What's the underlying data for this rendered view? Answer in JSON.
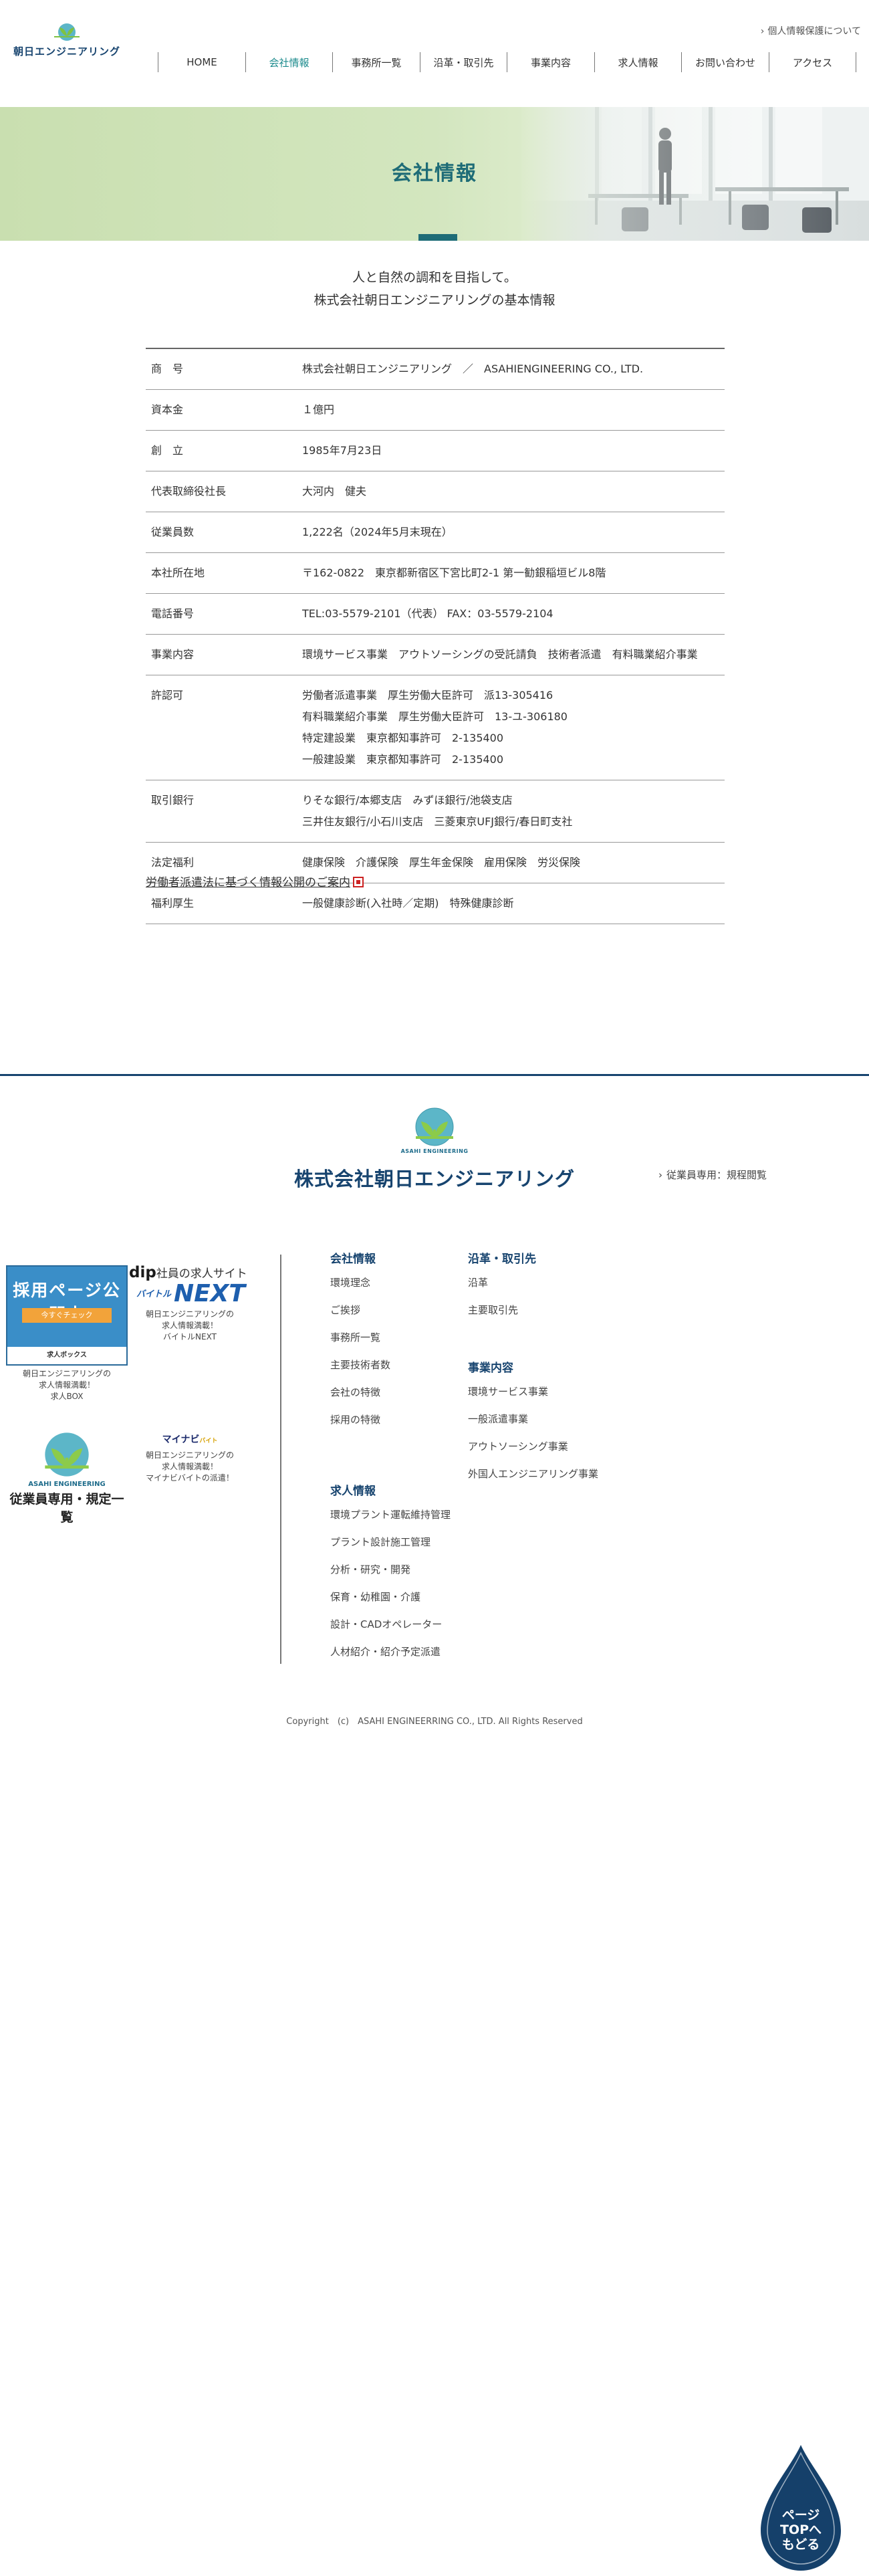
{
  "header": {
    "logo_text": "朝日エンジニアリング",
    "privacy_link": "個人情報保護について",
    "nav": [
      {
        "label": "HOME",
        "active": false
      },
      {
        "label": "会社情報",
        "active": true
      },
      {
        "label": "事務所一覧",
        "active": false
      },
      {
        "label": "沿革・取引先",
        "active": false
      },
      {
        "label": "事業内容",
        "active": false
      },
      {
        "label": "求人情報",
        "active": false
      },
      {
        "label": "お問い合わせ",
        "active": false
      },
      {
        "label": "アクセス",
        "active": false
      }
    ]
  },
  "hero": {
    "title": "会社情報"
  },
  "intro": {
    "line1": "人と自然の調和を目指して。",
    "line2": "株式会社朝日エンジニアリングの基本情報"
  },
  "info_table": [
    {
      "label": "商　号",
      "values": [
        "株式会社朝日エンジニアリング　／　ASAHIENGINEERING CO., LTD."
      ]
    },
    {
      "label": "資本金",
      "values": [
        "１億円"
      ]
    },
    {
      "label": "創　立",
      "values": [
        "1985年7月23日"
      ]
    },
    {
      "label": "代表取締役社長",
      "values": [
        "大河内　健夫"
      ]
    },
    {
      "label": "従業員数",
      "values": [
        "1,222名（2024年5月末現在）"
      ]
    },
    {
      "label": "本社所在地",
      "values": [
        "〒162-0822　東京都新宿区下宮比町2-1 第一勧銀稲垣ビル8階"
      ]
    },
    {
      "label": "電話番号",
      "values": [
        "TEL:03-5579-2101（代表）  FAX：03-5579-2104"
      ]
    },
    {
      "label": "事業内容",
      "values": [
        "環境サービス事業　アウトソーシングの受託請負　技術者派遣　有料職業紹介事業"
      ]
    },
    {
      "label": "許認可",
      "values": [
        "労働者派遣事業　厚生労働大臣許可　派13-305416",
        "有料職業紹介事業　厚生労働大臣許可　13-ユ-306180",
        "特定建設業　東京都知事許可　2-135400",
        "一般建設業　東京都知事許可　2-135400"
      ]
    },
    {
      "label": "取引銀行",
      "values": [
        "りそな銀行/本郷支店　みずほ銀行/池袋支店",
        "三井住友銀行/小石川支店　三菱東京UFJ銀行/春日町支社"
      ]
    },
    {
      "label": "法定福利",
      "values": [
        "健康保険　介護保険　厚生年金保険　雇用保険　労災保険"
      ]
    },
    {
      "label": "福利厚生",
      "values": [
        "一般健康診断(入社時／定期)　特殊健康診断"
      ]
    }
  ],
  "dispatch_link": "労働者派遣法に基づく情報公開のご案内",
  "footer": {
    "logo_en": "ASAHI ENGINEERING",
    "company_name": "株式会社朝日エンジニアリング",
    "employee_link": "従業員専用：規程閲覧",
    "banners": {
      "recruit_title": "採用ページ公開中",
      "recruit_bar": "今すぐチェック",
      "recruit_foot": "求人ボックス",
      "recruit_caption": [
        "朝日エンジニアリングの",
        "求人情報満載！",
        "求人BOX"
      ],
      "dip_brand": "dip",
      "dip_text": "社員の求人サイト",
      "next_prefix": "バイトル",
      "next_text": "NEXT",
      "next_caption": [
        "朝日エンジニアリングの",
        "求人情報満載！",
        "バイトルNEXT"
      ],
      "rules_logo": "ASAHI ENGINEERING",
      "rules_text": "従業員専用・規定一覧",
      "mynavi_logo": "マイナビ",
      "mynavi_sub": "バイト",
      "mynavi_caption": [
        "朝日エンジニアリングの",
        "求人情報満載！",
        "マイナビバイトの派遣！"
      ]
    },
    "columns": {
      "company": {
        "heading": "会社情報",
        "items": [
          "環境理念",
          "ご挨拶",
          "事務所一覧",
          "主要技術者数",
          "会社の特徴",
          "採用の特徴"
        ]
      },
      "history": {
        "heading": "沿革・取引先",
        "items": [
          "沿革",
          "主要取引先"
        ]
      },
      "business": {
        "heading": "事業内容",
        "items": [
          "環境サービス事業",
          "一般派遣事業",
          "アウトソーシング事業",
          "外国人エンジニアリング事業"
        ]
      },
      "recruit": {
        "heading": "求人情報",
        "items": [
          "環境プラント運転維持管理",
          "プラント設計施工管理",
          "分析・研究・開発",
          "保育・幼稚園・介護",
          "設計・CADオペレーター",
          "人材紹介・紹介予定派遣"
        ]
      }
    },
    "copyright": "Copyright　(c)　ASAHI ENGINEERRING CO., LTD. All Rights Reserved"
  },
  "page_top": {
    "line1": "ページ",
    "line2": "TOPへ",
    "line3": "もどる"
  },
  "colors": {
    "navy": "#17446f",
    "teal": "#1e6c77",
    "active_nav": "#1b8a8c",
    "hero_green": "#c9dfb0"
  },
  "icons": [
    "chevron-right-icon",
    "pdf-icon",
    "leaf-emblem-icon",
    "page-top-drop-icon"
  ]
}
